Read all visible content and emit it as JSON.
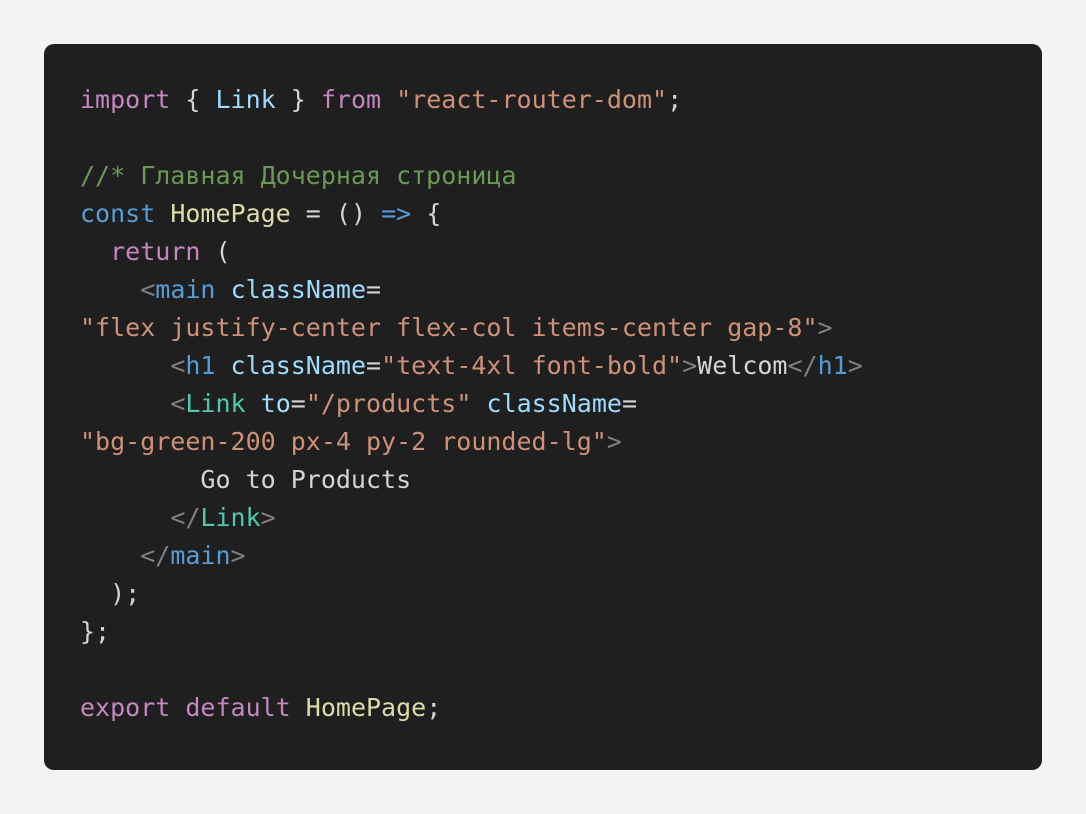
{
  "code": {
    "lines": [
      {
        "tokens": [
          {
            "t": "import",
            "c": "t-kw"
          },
          {
            "t": " { ",
            "c": "t-punc"
          },
          {
            "t": "Link",
            "c": "t-id"
          },
          {
            "t": " } ",
            "c": "t-punc"
          },
          {
            "t": "from",
            "c": "t-kw"
          },
          {
            "t": " ",
            "c": "t-punc"
          },
          {
            "t": "\"react-router-dom\"",
            "c": "t-str"
          },
          {
            "t": ";",
            "c": "t-punc"
          }
        ]
      },
      {
        "tokens": []
      },
      {
        "tokens": [
          {
            "t": "//* Главная Дочерная строница",
            "c": "t-comment"
          }
        ]
      },
      {
        "tokens": [
          {
            "t": "const",
            "c": "t-const"
          },
          {
            "t": " ",
            "c": "t-punc"
          },
          {
            "t": "HomePage",
            "c": "t-fn"
          },
          {
            "t": " = () ",
            "c": "t-punc"
          },
          {
            "t": "=>",
            "c": "t-const"
          },
          {
            "t": " {",
            "c": "t-punc"
          }
        ]
      },
      {
        "tokens": [
          {
            "t": "  ",
            "c": "t-punc"
          },
          {
            "t": "return",
            "c": "t-kw"
          },
          {
            "t": " (",
            "c": "t-punc"
          }
        ]
      },
      {
        "tokens": [
          {
            "t": "    ",
            "c": "t-punc"
          },
          {
            "t": "<",
            "c": "t-tagpunc"
          },
          {
            "t": "main",
            "c": "t-tag"
          },
          {
            "t": " ",
            "c": "t-punc"
          },
          {
            "t": "className",
            "c": "t-id"
          },
          {
            "t": "=",
            "c": "t-punc"
          }
        ]
      },
      {
        "tokens": [
          {
            "t": "\"flex justify-center flex-col items-center gap-8\"",
            "c": "t-str"
          },
          {
            "t": ">",
            "c": "t-tagpunc"
          }
        ]
      },
      {
        "tokens": [
          {
            "t": "      ",
            "c": "t-punc"
          },
          {
            "t": "<",
            "c": "t-tagpunc"
          },
          {
            "t": "h1",
            "c": "t-tag"
          },
          {
            "t": " ",
            "c": "t-punc"
          },
          {
            "t": "className",
            "c": "t-id"
          },
          {
            "t": "=",
            "c": "t-punc"
          },
          {
            "t": "\"text-4xl font-bold\"",
            "c": "t-str"
          },
          {
            "t": ">",
            "c": "t-tagpunc"
          },
          {
            "t": "Welcom",
            "c": "t-text"
          },
          {
            "t": "</",
            "c": "t-tagpunc"
          },
          {
            "t": "h1",
            "c": "t-tag"
          },
          {
            "t": ">",
            "c": "t-tagpunc"
          }
        ]
      },
      {
        "tokens": [
          {
            "t": "      ",
            "c": "t-punc"
          },
          {
            "t": "<",
            "c": "t-tagpunc"
          },
          {
            "t": "Link",
            "c": "t-comp"
          },
          {
            "t": " ",
            "c": "t-punc"
          },
          {
            "t": "to",
            "c": "t-id"
          },
          {
            "t": "=",
            "c": "t-punc"
          },
          {
            "t": "\"/products\"",
            "c": "t-str"
          },
          {
            "t": " ",
            "c": "t-punc"
          },
          {
            "t": "className",
            "c": "t-id"
          },
          {
            "t": "=",
            "c": "t-punc"
          }
        ]
      },
      {
        "tokens": [
          {
            "t": "\"bg-green-200 px-4 py-2 rounded-lg\"",
            "c": "t-str"
          },
          {
            "t": ">",
            "c": "t-tagpunc"
          }
        ]
      },
      {
        "tokens": [
          {
            "t": "        Go to Products",
            "c": "t-text"
          }
        ]
      },
      {
        "tokens": [
          {
            "t": "      ",
            "c": "t-punc"
          },
          {
            "t": "</",
            "c": "t-tagpunc"
          },
          {
            "t": "Link",
            "c": "t-comp"
          },
          {
            "t": ">",
            "c": "t-tagpunc"
          }
        ]
      },
      {
        "tokens": [
          {
            "t": "    ",
            "c": "t-punc"
          },
          {
            "t": "</",
            "c": "t-tagpunc"
          },
          {
            "t": "main",
            "c": "t-tag"
          },
          {
            "t": ">",
            "c": "t-tagpunc"
          }
        ]
      },
      {
        "tokens": [
          {
            "t": "  );",
            "c": "t-punc"
          }
        ]
      },
      {
        "tokens": [
          {
            "t": "};",
            "c": "t-punc"
          }
        ]
      },
      {
        "tokens": []
      },
      {
        "tokens": [
          {
            "t": "export",
            "c": "t-kw"
          },
          {
            "t": " ",
            "c": "t-punc"
          },
          {
            "t": "default",
            "c": "t-kw"
          },
          {
            "t": " ",
            "c": "t-punc"
          },
          {
            "t": "HomePage",
            "c": "t-fn"
          },
          {
            "t": ";",
            "c": "t-punc"
          }
        ]
      }
    ]
  },
  "colors": {
    "page_bg": "#f2f2f2",
    "code_bg": "#1f1f1f"
  }
}
